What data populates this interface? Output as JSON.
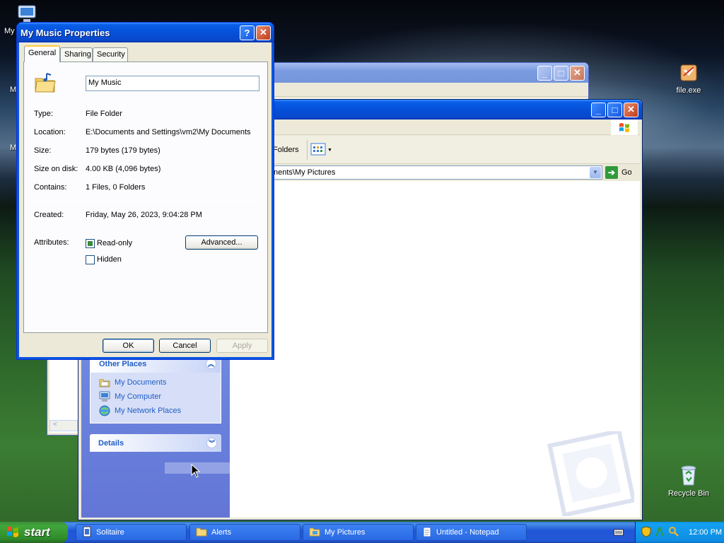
{
  "desktop": {
    "icons": [
      {
        "label": "file.exe",
        "icon": "exe-icon"
      },
      {
        "label": "Recycle Bin",
        "icon": "recycle-bin-icon"
      },
      {
        "label": "My",
        "icon": "computer-icon"
      },
      {
        "label": "M",
        "icon": "partial-icon"
      },
      {
        "label": "M",
        "icon": "partial-icon"
      }
    ]
  },
  "dialog": {
    "title": "My Music Properties",
    "help_btn": "?",
    "close_btn": "✕",
    "tabs": [
      "General",
      "Sharing",
      "Security"
    ],
    "name_value": "My Music",
    "fields": [
      {
        "label": "Type:",
        "value": "File Folder"
      },
      {
        "label": "Location:",
        "value": "E:\\Documents and Settings\\vm2\\My Documents"
      },
      {
        "label": "Size:",
        "value": "179 bytes (179 bytes)"
      },
      {
        "label": "Size on disk:",
        "value": "4.00 KB (4,096 bytes)"
      },
      {
        "label": "Contains:",
        "value": "1 Files, 0 Folders"
      }
    ],
    "created_label": "Created:",
    "created_value": "Friday, May 26, 2023, 9:04:28 PM",
    "attributes_label": "Attributes:",
    "readonly_label": "Read-only",
    "readonly_checked": true,
    "hidden_label": "Hidden",
    "hidden_checked": false,
    "advanced_btn": "Advanced...",
    "ok_btn": "OK",
    "cancel_btn": "Cancel",
    "apply_btn": "Apply"
  },
  "explorer": {
    "min_btn": "_",
    "max_btn": "□",
    "close_btn": "✕",
    "folders_label": "Folders",
    "address_value": "nents\\My Pictures",
    "go_label": "Go",
    "other_places": {
      "title": "Other Places",
      "items": [
        {
          "label": "My Documents",
          "icon": "my-documents-icon"
        },
        {
          "label": "My Computer",
          "icon": "my-computer-icon"
        },
        {
          "label": "My Network Places",
          "icon": "network-places-icon"
        }
      ]
    },
    "details_title": "Details"
  },
  "taskbar": {
    "start_label": "start",
    "items": [
      {
        "label": "Solitaire",
        "icon": "solitaire-icon"
      },
      {
        "label": "Alerts",
        "icon": "folder-icon"
      },
      {
        "label": "My Pictures",
        "icon": "pictures-icon"
      },
      {
        "label": "Untitled - Notepad",
        "icon": "notepad-icon"
      }
    ],
    "clock": "12:00 PM"
  }
}
